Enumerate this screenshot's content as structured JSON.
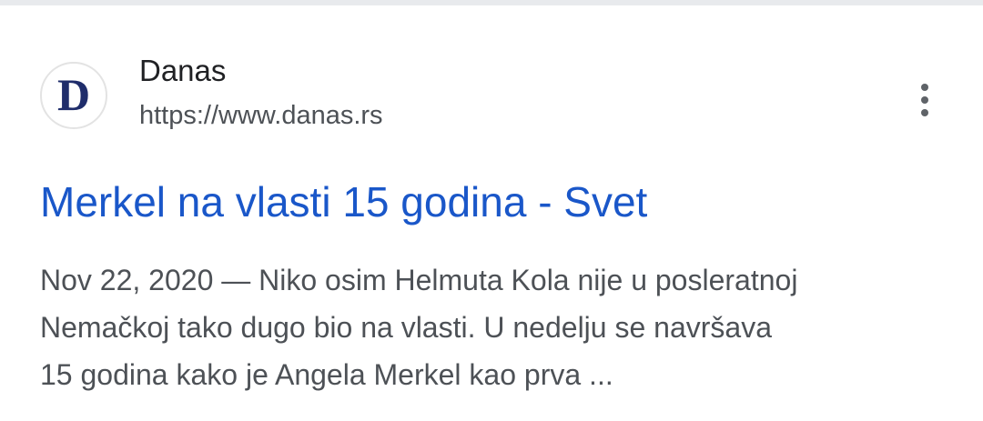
{
  "site": {
    "name": "Danas",
    "url": "https://www.danas.rs",
    "logo_letter": "D",
    "logo_color": "#1f2d6b"
  },
  "more_menu": {
    "icon": "more-vert-icon"
  },
  "result": {
    "title": "Merkel na vlasti 15 godina - Svet",
    "snippet_lines": [
      "Nov 22, 2020 — Niko osim Helmuta Kola nije u posleratnoj",
      "Nemačkoj tako dugo bio na vlasti. U nedelju se navršava",
      "15 godina kako je Angela Merkel kao prva ..."
    ]
  },
  "colors": {
    "title_link": "#1a57c9",
    "secondary_text": "#4d5156",
    "primary_text": "#202124"
  }
}
